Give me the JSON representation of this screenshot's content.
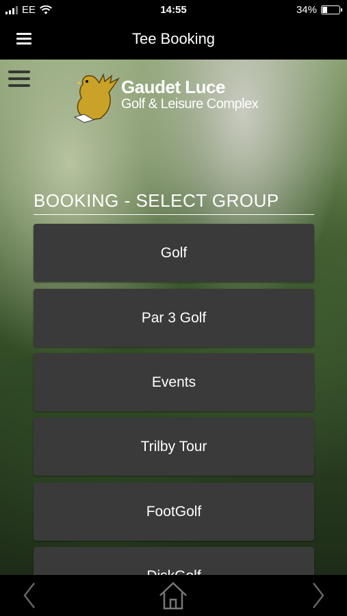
{
  "status_bar": {
    "carrier": "EE",
    "time": "14:55",
    "battery": "34%",
    "battery_level": 0.34
  },
  "header": {
    "title": "Tee Booking",
    "menu_icon": "hamburger-icon"
  },
  "logo": {
    "line1": "Gaudet Luce",
    "line2": "Golf & Leisure Complex"
  },
  "section": {
    "heading": "BOOKING - SELECT GROUP"
  },
  "groups": [
    {
      "label": "Golf"
    },
    {
      "label": "Par 3 Golf"
    },
    {
      "label": "Events"
    },
    {
      "label": "Trilby Tour"
    },
    {
      "label": "FootGolf"
    },
    {
      "label": "DiskGolf"
    }
  ],
  "bottom_nav": {
    "back": "chevron-left-icon",
    "home": "home-icon",
    "forward": "chevron-right-icon"
  }
}
